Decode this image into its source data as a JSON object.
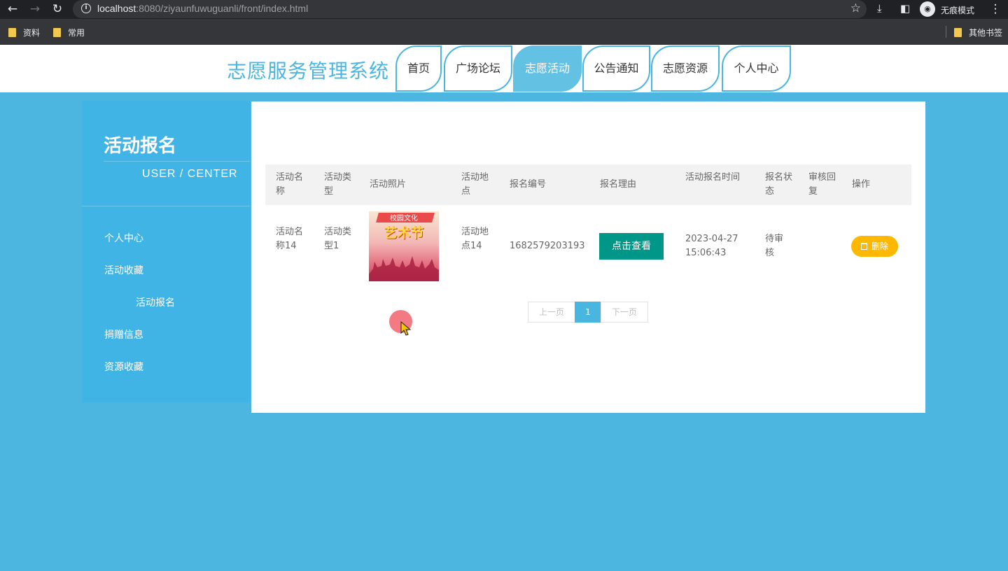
{
  "browser": {
    "url_host": "localhost",
    "url_rest": ":8080/ziyaunfuwuguanli/front/index.html",
    "incognito_label": "无痕模式",
    "bookmarks": [
      "资料",
      "常用"
    ],
    "other_bookmarks": "其他书签"
  },
  "header": {
    "site_title": "志愿服务管理系统",
    "nav": [
      "首页",
      "广场论坛",
      "志愿活动",
      "公告通知",
      "志愿资源",
      "个人中心"
    ],
    "active_nav": "志愿活动"
  },
  "sidebar": {
    "title": "活动报名",
    "subtitle": "USER / CENTER",
    "items": [
      "个人中心",
      "活动收藏",
      "活动报名",
      "捐赠信息",
      "资源收藏"
    ]
  },
  "table": {
    "headers": [
      "活动名称",
      "活动类型",
      "活动照片",
      "活动地点",
      "报名编号",
      "报名理由",
      "活动报名时间",
      "报名状态",
      "审核回复",
      "操作"
    ],
    "rows": [
      {
        "name": "活动名称14",
        "type": "活动类型1",
        "photo_banner": "校园文化",
        "photo_title": "艺术节",
        "location": "活动地点14",
        "number": "1682579203193",
        "reason_button": "点击查看",
        "time": "2023-04-27 15:06:43",
        "status": "待审核",
        "reply": "",
        "delete_button": "删除"
      }
    ]
  },
  "pagination": {
    "prev": "上一页",
    "current": "1",
    "next": "下一页"
  },
  "colors": {
    "accent": "#49b6e0",
    "view_button": "#009688",
    "delete_button": "#ffb800"
  }
}
